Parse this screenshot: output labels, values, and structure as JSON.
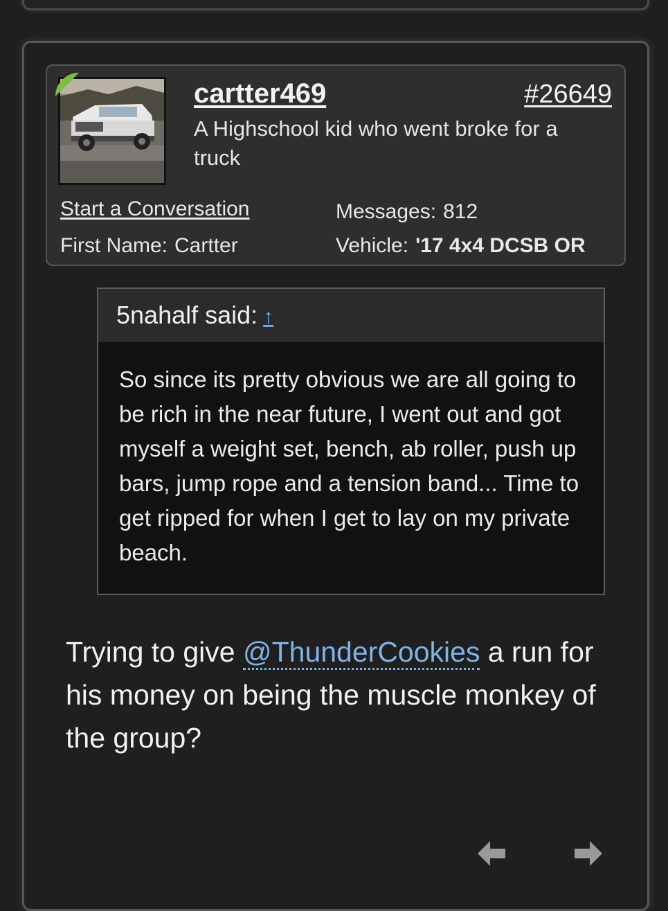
{
  "post": {
    "author": {
      "username": "cartter469",
      "user_title": "A Highschool kid who went broke for a truck",
      "start_conversation_label": "Start a Conversation",
      "first_name_label": "First Name:",
      "first_name_value": "Cartter",
      "messages_label": "Messages:",
      "messages_value": "812",
      "vehicle_label": "Vehicle:",
      "vehicle_value": "'17 4x4 DCSB OR",
      "online_color": "#7bbf3f"
    },
    "post_number": "#26649",
    "quote": {
      "attribution": "5nahalf said:",
      "jump_icon": "up-arrow-icon",
      "jump_glyph": "↑",
      "text": "So since its pretty obvious we are all going to be rich in the near future, I went out and got myself a weight set, bench, ab roller, push up bars, jump rope and a tension band... Time to get ripped for when I get to lay on my private beach."
    },
    "message": {
      "before_mention": "Trying to give ",
      "mention": "@ThunderCookies",
      "after_mention": " a run for his money on being the muscle monkey of the group?"
    },
    "nav": {
      "prev_icon": "left-arrow-icon",
      "next_icon": "right-arrow-icon"
    }
  },
  "colors": {
    "background": "#1e1e1e",
    "card": "#2e2e2e",
    "link_accent": "#7fb3e6",
    "arrow_gray": "#9a9a9a"
  }
}
